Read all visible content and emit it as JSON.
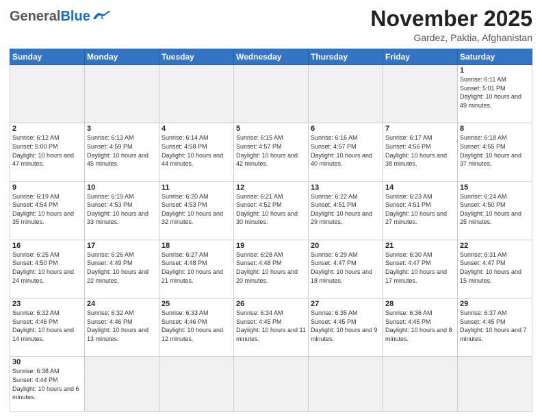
{
  "header": {
    "logo_general": "General",
    "logo_blue": "Blue",
    "title": "November 2025",
    "location": "Gardez, Paktia, Afghanistan"
  },
  "days_of_week": [
    "Sunday",
    "Monday",
    "Tuesday",
    "Wednesday",
    "Thursday",
    "Friday",
    "Saturday"
  ],
  "weeks": [
    {
      "cells": [
        {
          "day": null,
          "empty": true
        },
        {
          "day": null,
          "empty": true
        },
        {
          "day": null,
          "empty": true
        },
        {
          "day": null,
          "empty": true
        },
        {
          "day": null,
          "empty": true
        },
        {
          "day": null,
          "empty": true
        },
        {
          "day": "1",
          "sunrise": "6:11 AM",
          "sunset": "5:01 PM",
          "daylight": "10 hours and 49 minutes."
        }
      ]
    },
    {
      "cells": [
        {
          "day": "2",
          "sunrise": "6:12 AM",
          "sunset": "5:00 PM",
          "daylight": "10 hours and 47 minutes."
        },
        {
          "day": "3",
          "sunrise": "6:13 AM",
          "sunset": "4:59 PM",
          "daylight": "10 hours and 45 minutes."
        },
        {
          "day": "4",
          "sunrise": "6:14 AM",
          "sunset": "4:58 PM",
          "daylight": "10 hours and 44 minutes."
        },
        {
          "day": "5",
          "sunrise": "6:15 AM",
          "sunset": "4:57 PM",
          "daylight": "10 hours and 42 minutes."
        },
        {
          "day": "6",
          "sunrise": "6:16 AM",
          "sunset": "4:57 PM",
          "daylight": "10 hours and 40 minutes."
        },
        {
          "day": "7",
          "sunrise": "6:17 AM",
          "sunset": "4:56 PM",
          "daylight": "10 hours and 38 minutes."
        },
        {
          "day": "8",
          "sunrise": "6:18 AM",
          "sunset": "4:55 PM",
          "daylight": "10 hours and 37 minutes."
        }
      ]
    },
    {
      "cells": [
        {
          "day": "9",
          "sunrise": "6:19 AM",
          "sunset": "4:54 PM",
          "daylight": "10 hours and 35 minutes."
        },
        {
          "day": "10",
          "sunrise": "6:19 AM",
          "sunset": "4:53 PM",
          "daylight": "10 hours and 33 minutes."
        },
        {
          "day": "11",
          "sunrise": "6:20 AM",
          "sunset": "4:53 PM",
          "daylight": "10 hours and 32 minutes."
        },
        {
          "day": "12",
          "sunrise": "6:21 AM",
          "sunset": "4:52 PM",
          "daylight": "10 hours and 30 minutes."
        },
        {
          "day": "13",
          "sunrise": "6:22 AM",
          "sunset": "4:51 PM",
          "daylight": "10 hours and 29 minutes."
        },
        {
          "day": "14",
          "sunrise": "6:23 AM",
          "sunset": "4:51 PM",
          "daylight": "10 hours and 27 minutes."
        },
        {
          "day": "15",
          "sunrise": "6:24 AM",
          "sunset": "4:50 PM",
          "daylight": "10 hours and 25 minutes."
        }
      ]
    },
    {
      "cells": [
        {
          "day": "16",
          "sunrise": "6:25 AM",
          "sunset": "4:50 PM",
          "daylight": "10 hours and 24 minutes."
        },
        {
          "day": "17",
          "sunrise": "6:26 AM",
          "sunset": "4:49 PM",
          "daylight": "10 hours and 22 minutes."
        },
        {
          "day": "18",
          "sunrise": "6:27 AM",
          "sunset": "4:48 PM",
          "daylight": "10 hours and 21 minutes."
        },
        {
          "day": "19",
          "sunrise": "6:28 AM",
          "sunset": "4:48 PM",
          "daylight": "10 hours and 20 minutes."
        },
        {
          "day": "20",
          "sunrise": "6:29 AM",
          "sunset": "4:47 PM",
          "daylight": "10 hours and 18 minutes."
        },
        {
          "day": "21",
          "sunrise": "6:30 AM",
          "sunset": "4:47 PM",
          "daylight": "10 hours and 17 minutes."
        },
        {
          "day": "22",
          "sunrise": "6:31 AM",
          "sunset": "4:47 PM",
          "daylight": "10 hours and 15 minutes."
        }
      ]
    },
    {
      "cells": [
        {
          "day": "23",
          "sunrise": "6:32 AM",
          "sunset": "4:46 PM",
          "daylight": "10 hours and 14 minutes."
        },
        {
          "day": "24",
          "sunrise": "6:32 AM",
          "sunset": "4:46 PM",
          "daylight": "10 hours and 13 minutes."
        },
        {
          "day": "25",
          "sunrise": "6:33 AM",
          "sunset": "4:46 PM",
          "daylight": "10 hours and 12 minutes."
        },
        {
          "day": "26",
          "sunrise": "6:34 AM",
          "sunset": "4:45 PM",
          "daylight": "10 hours and 11 minutes."
        },
        {
          "day": "27",
          "sunrise": "6:35 AM",
          "sunset": "4:45 PM",
          "daylight": "10 hours and 9 minutes."
        },
        {
          "day": "28",
          "sunrise": "6:36 AM",
          "sunset": "4:45 PM",
          "daylight": "10 hours and 8 minutes."
        },
        {
          "day": "29",
          "sunrise": "6:37 AM",
          "sunset": "4:45 PM",
          "daylight": "10 hours and 7 minutes."
        }
      ]
    },
    {
      "cells": [
        {
          "day": "30",
          "sunrise": "6:38 AM",
          "sunset": "4:44 PM",
          "daylight": "10 hours and 6 minutes."
        },
        {
          "day": null,
          "empty": true
        },
        {
          "day": null,
          "empty": true
        },
        {
          "day": null,
          "empty": true
        },
        {
          "day": null,
          "empty": true
        },
        {
          "day": null,
          "empty": true
        },
        {
          "day": null,
          "empty": true
        }
      ]
    }
  ]
}
